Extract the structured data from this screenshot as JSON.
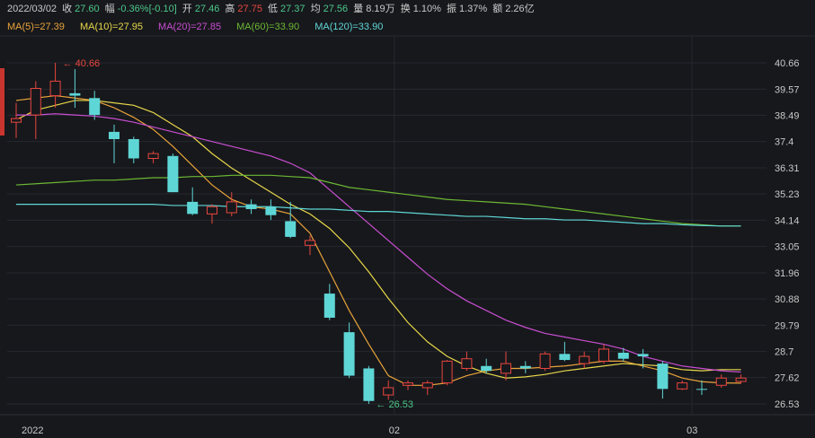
{
  "header": {
    "date": "2022/03/02",
    "close_label": "收",
    "close": "27.60",
    "change_label": "幅",
    "change": "-0.36%[-0.10]",
    "open_label": "开",
    "open": "27.46",
    "high_label": "高",
    "high": "27.75",
    "low_label": "低",
    "low": "27.37",
    "avg_label": "均",
    "avg": "27.56",
    "volume_label": "量",
    "volume": "8.19万",
    "turnover_label": "换",
    "turnover": "1.10%",
    "amplitude_label": "振",
    "amplitude": "1.37%",
    "amount_label": "额",
    "amount": "2.26亿"
  },
  "ma_legend": [
    {
      "text": "MA(5)=27.39",
      "color": "#e8a33a"
    },
    {
      "text": "MA(10)=27.95",
      "color": "#e6d74a"
    },
    {
      "text": "MA(20)=27.85",
      "color": "#c84ed0"
    },
    {
      "text": "MA(60)=33.90",
      "color": "#6cb833"
    },
    {
      "text": "MA(120)=33.90",
      "color": "#5fd6d6"
    }
  ],
  "colors": {
    "up": "#e8463f",
    "down": "#5fd6d6",
    "grid": "#262930",
    "axis_text": "#c8c8c8",
    "background": "#17181c"
  },
  "chart_data": {
    "type": "candlestick",
    "ylim": [
      26.0,
      41.5
    ],
    "yticks": [
      "40.66",
      "39.57",
      "38.49",
      "37.4",
      "36.31",
      "35.23",
      "34.14",
      "33.05",
      "31.96",
      "30.88",
      "29.79",
      "28.7",
      "27.62",
      "26.53"
    ],
    "x_labels": [
      {
        "label": "2022",
        "index": 0
      },
      {
        "label": "02",
        "index": 19.3
      },
      {
        "label": "03",
        "index": 34.5
      }
    ],
    "annotations": [
      {
        "text": "40.66",
        "index": 2,
        "value": 40.66,
        "type": "high"
      },
      {
        "text": "26.53",
        "index": 18,
        "value": 26.53,
        "type": "low"
      }
    ],
    "candles": [
      {
        "o": 38.2,
        "c": 38.35,
        "h": 39.0,
        "l": 37.55
      },
      {
        "o": 38.5,
        "c": 39.6,
        "h": 39.9,
        "l": 37.5
      },
      {
        "o": 39.3,
        "c": 39.9,
        "h": 40.66,
        "l": 38.8
      },
      {
        "o": 39.4,
        "c": 39.3,
        "h": 40.4,
        "l": 38.8
      },
      {
        "o": 39.2,
        "c": 38.5,
        "h": 39.5,
        "l": 38.3
      },
      {
        "o": 37.8,
        "c": 37.5,
        "h": 38.1,
        "l": 36.5
      },
      {
        "o": 37.5,
        "c": 36.7,
        "h": 37.6,
        "l": 36.5
      },
      {
        "o": 36.7,
        "c": 36.9,
        "h": 37.0,
        "l": 36.5
      },
      {
        "o": 36.8,
        "c": 35.3,
        "h": 36.9,
        "l": 35.3
      },
      {
        "o": 34.9,
        "c": 34.4,
        "h": 35.5,
        "l": 34.35
      },
      {
        "o": 34.4,
        "c": 34.7,
        "h": 34.8,
        "l": 34.0
      },
      {
        "o": 34.45,
        "c": 34.9,
        "h": 35.3,
        "l": 34.3
      },
      {
        "o": 34.8,
        "c": 34.6,
        "h": 35.0,
        "l": 34.4
      },
      {
        "o": 34.7,
        "c": 34.35,
        "h": 35.0,
        "l": 34.15
      },
      {
        "o": 34.1,
        "c": 33.45,
        "h": 34.9,
        "l": 33.4
      },
      {
        "o": 33.1,
        "c": 33.3,
        "h": 33.5,
        "l": 32.7
      },
      {
        "o": 31.1,
        "c": 30.1,
        "h": 31.5,
        "l": 30.0
      },
      {
        "o": 29.5,
        "c": 27.7,
        "h": 29.9,
        "l": 27.6
      },
      {
        "o": 28.0,
        "c": 26.65,
        "h": 28.1,
        "l": 26.53
      },
      {
        "o": 26.9,
        "c": 27.2,
        "h": 27.5,
        "l": 26.7
      },
      {
        "o": 27.3,
        "c": 27.4,
        "h": 27.5,
        "l": 27.1
      },
      {
        "o": 27.2,
        "c": 27.4,
        "h": 27.5,
        "l": 26.9
      },
      {
        "o": 27.4,
        "c": 28.3,
        "h": 28.35,
        "l": 27.3
      },
      {
        "o": 28.0,
        "c": 28.4,
        "h": 28.7,
        "l": 27.9
      },
      {
        "o": 28.1,
        "c": 27.9,
        "h": 28.4,
        "l": 27.8
      },
      {
        "o": 27.8,
        "c": 28.2,
        "h": 28.7,
        "l": 27.5
      },
      {
        "o": 28.1,
        "c": 28.0,
        "h": 28.3,
        "l": 27.8
      },
      {
        "o": 28.0,
        "c": 28.6,
        "h": 28.7,
        "l": 27.9
      },
      {
        "o": 28.6,
        "c": 28.35,
        "h": 29.1,
        "l": 28.3
      },
      {
        "o": 28.2,
        "c": 28.5,
        "h": 28.7,
        "l": 28.0
      },
      {
        "o": 28.3,
        "c": 28.8,
        "h": 29.0,
        "l": 28.2
      },
      {
        "o": 28.65,
        "c": 28.4,
        "h": 28.85,
        "l": 28.3
      },
      {
        "o": 28.6,
        "c": 28.5,
        "h": 28.8,
        "l": 28.0
      },
      {
        "o": 28.2,
        "c": 27.15,
        "h": 28.3,
        "l": 26.75
      },
      {
        "o": 27.15,
        "c": 27.4,
        "h": 27.5,
        "l": 27.1
      },
      {
        "o": 27.15,
        "c": 27.12,
        "h": 27.5,
        "l": 26.9
      },
      {
        "o": 27.3,
        "c": 27.6,
        "h": 27.75,
        "l": 27.2
      },
      {
        "o": 27.46,
        "c": 27.6,
        "h": 27.75,
        "l": 27.37
      }
    ],
    "ma_series": [
      {
        "name": "MA(5)",
        "color": "#e8a33a",
        "values": [
          39.1,
          39.2,
          39.3,
          39.2,
          39.1,
          38.8,
          38.4,
          37.9,
          37.2,
          36.4,
          35.6,
          35.0,
          34.7,
          34.6,
          34.4,
          33.6,
          32.0,
          30.4,
          29.0,
          27.7,
          27.3,
          27.3,
          27.4,
          27.7,
          27.9,
          28.0,
          28.0,
          28.05,
          28.1,
          28.2,
          28.3,
          28.3,
          28.1,
          27.9,
          27.6,
          27.45,
          27.4,
          27.39
        ]
      },
      {
        "name": "MA(10)",
        "color": "#e6d74a",
        "values": [
          38.3,
          38.7,
          38.9,
          39.1,
          39.1,
          39.0,
          38.9,
          38.6,
          38.1,
          37.6,
          36.9,
          36.3,
          35.8,
          35.3,
          34.8,
          34.4,
          33.8,
          33.0,
          32.0,
          30.9,
          29.9,
          29.1,
          28.5,
          28.1,
          27.8,
          27.6,
          27.65,
          27.75,
          27.9,
          28.0,
          28.1,
          28.2,
          28.15,
          28.1,
          27.95,
          27.9,
          27.95,
          27.95
        ]
      },
      {
        "name": "MA(20)",
        "color": "#c84ed0",
        "values": [
          38.5,
          38.5,
          38.55,
          38.5,
          38.45,
          38.35,
          38.2,
          38.0,
          37.8,
          37.6,
          37.4,
          37.2,
          37.0,
          36.8,
          36.5,
          36.1,
          35.4,
          34.7,
          34.0,
          33.3,
          32.6,
          31.9,
          31.3,
          30.8,
          30.4,
          30.0,
          29.7,
          29.45,
          29.3,
          29.15,
          29.0,
          28.8,
          28.5,
          28.3,
          28.1,
          28.0,
          27.9,
          27.85
        ]
      },
      {
        "name": "MA(60)",
        "color": "#6cb833",
        "values": [
          35.6,
          35.65,
          35.7,
          35.75,
          35.8,
          35.8,
          35.85,
          35.9,
          35.9,
          35.95,
          35.95,
          36.0,
          36.0,
          36.0,
          35.95,
          35.9,
          35.7,
          35.5,
          35.4,
          35.3,
          35.2,
          35.1,
          35.0,
          34.95,
          34.9,
          34.85,
          34.8,
          34.7,
          34.6,
          34.5,
          34.4,
          34.3,
          34.2,
          34.1,
          34.0,
          33.95,
          33.9,
          33.9
        ]
      },
      {
        "name": "MA(120)",
        "color": "#5fd6d6",
        "values": [
          34.8,
          34.8,
          34.8,
          34.8,
          34.8,
          34.8,
          34.8,
          34.8,
          34.75,
          34.75,
          34.75,
          34.7,
          34.7,
          34.7,
          34.65,
          34.6,
          34.6,
          34.55,
          34.5,
          34.5,
          34.45,
          34.4,
          34.35,
          34.3,
          34.3,
          34.25,
          34.2,
          34.2,
          34.15,
          34.15,
          34.1,
          34.05,
          34.0,
          34.0,
          33.95,
          33.92,
          33.9,
          33.9
        ]
      }
    ]
  }
}
